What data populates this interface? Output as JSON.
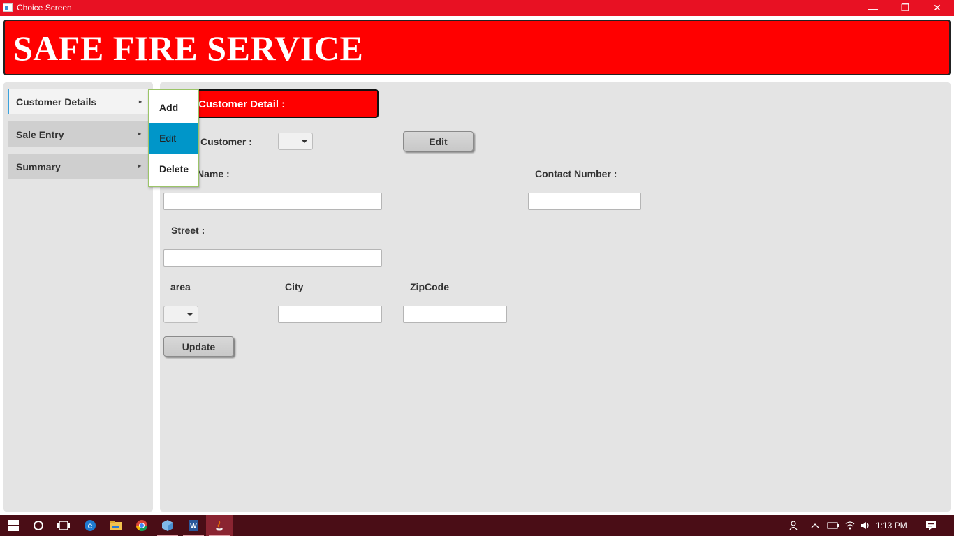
{
  "window": {
    "title": "Choice Screen",
    "controls": {
      "minimize": "—",
      "restore": "❐",
      "close": "✕"
    }
  },
  "banner": {
    "brand": "SAFE FIRE SERVICE"
  },
  "sidebar": {
    "items": [
      {
        "label": "Customer Details",
        "arrow": "▸",
        "active": true
      },
      {
        "label": "Sale Entry",
        "arrow": "▸"
      },
      {
        "label": "Summary",
        "arrow": "▸"
      }
    ],
    "submenu": [
      {
        "label": "Add"
      },
      {
        "label": "Edit",
        "selected": true
      },
      {
        "label": "Delete"
      }
    ]
  },
  "form": {
    "section_title": "Customer Detail :",
    "customer_label": "Customer :",
    "customer_value": "",
    "edit_button": "Edit",
    "name_label": "Name :",
    "name_value": "",
    "contact_label": "Contact Number :",
    "contact_value": "",
    "street_label": "Street :",
    "street_value": "",
    "area_label": "area",
    "area_value": "",
    "city_label": "City",
    "city_value": "",
    "zip_label": "ZipCode",
    "zip_value": "",
    "update_button": "Update"
  },
  "taskbar": {
    "icons": [
      "windows-start-icon",
      "search-circle-icon",
      "task-view-icon",
      "edge-icon",
      "file-explorer-icon",
      "chrome-icon",
      "box-app-icon",
      "word-icon",
      "java-icon"
    ],
    "clock": "1:13 PM",
    "colors": {
      "bar": "#4a0d16",
      "active": "#8a2431"
    }
  },
  "colors": {
    "accent_red": "#ff0000",
    "title_red": "#e81123",
    "selection_blue": "#0096c9",
    "panel_gray": "#e4e4e4"
  }
}
